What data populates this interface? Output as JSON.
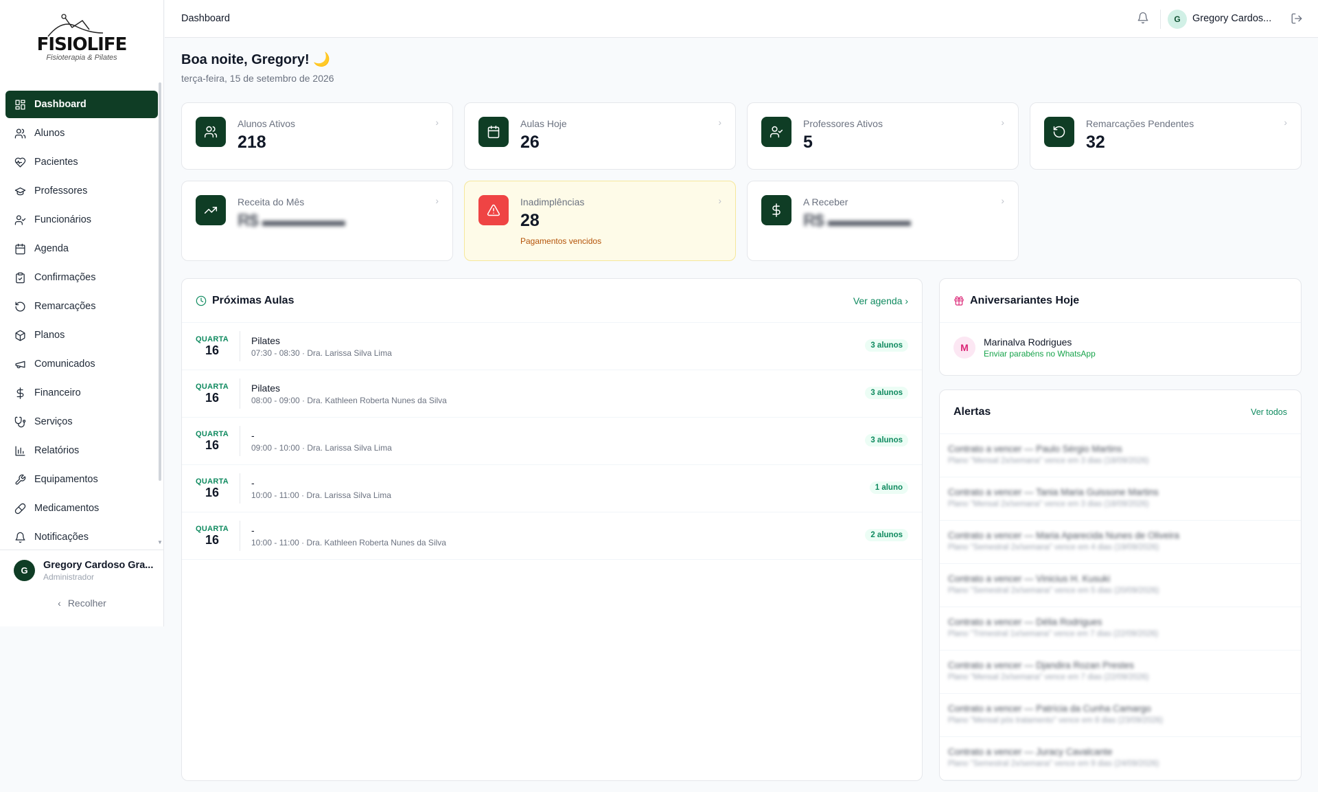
{
  "brand": {
    "name": "FISIOLIFE",
    "tagline": "Fisioterapia & Pilates"
  },
  "sidebar": {
    "items": [
      {
        "label": "Dashboard",
        "icon": "grid-icon",
        "active": true
      },
      {
        "label": "Alunos",
        "icon": "users-icon"
      },
      {
        "label": "Pacientes",
        "icon": "heart-pulse-icon"
      },
      {
        "label": "Professores",
        "icon": "graduation-cap-icon"
      },
      {
        "label": "Funcionários",
        "icon": "user-check-icon"
      },
      {
        "label": "Agenda",
        "icon": "calendar-icon"
      },
      {
        "label": "Confirmações",
        "icon": "clipboard-check-icon"
      },
      {
        "label": "Remarcações",
        "icon": "rotate-ccw-icon"
      },
      {
        "label": "Planos",
        "icon": "package-icon"
      },
      {
        "label": "Comunicados",
        "icon": "megaphone-icon"
      },
      {
        "label": "Financeiro",
        "icon": "dollar-icon"
      },
      {
        "label": "Serviços",
        "icon": "stethoscope-icon"
      },
      {
        "label": "Relatórios",
        "icon": "bar-chart-icon"
      },
      {
        "label": "Equipamentos",
        "icon": "wrench-icon"
      },
      {
        "label": "Medicamentos",
        "icon": "pill-icon"
      },
      {
        "label": "Notificações",
        "icon": "bell-icon"
      }
    ],
    "user": {
      "initial": "G",
      "name": "Gregory Cardoso Gra...",
      "role": "Administrador"
    },
    "collapse_label": "Recolher"
  },
  "header": {
    "title": "Dashboard",
    "user_initial": "G",
    "user_name": "Gregory Cardos..."
  },
  "greeting": {
    "text": "Boa noite, Gregory! 🌙",
    "date": "terça-feira, 15 de setembro de 2026"
  },
  "stats": [
    {
      "label": "Alunos Ativos",
      "value": "218",
      "icon": "users-icon"
    },
    {
      "label": "Aulas Hoje",
      "value": "26",
      "icon": "calendar-icon"
    },
    {
      "label": "Professores Ativos",
      "value": "5",
      "icon": "user-check-icon"
    },
    {
      "label": "Remarcações Pendentes",
      "value": "32",
      "icon": "rotate-ccw-icon"
    },
    {
      "label": "Receita do Mês",
      "value": "R$ ▬▬▬▬▬",
      "icon": "trending-up-icon"
    },
    {
      "label": "Inadimplências",
      "value": "28",
      "sub": "Pagamentos vencidos",
      "icon": "alert-triangle-icon"
    },
    {
      "label": "A Receber",
      "value": "R$ ▬▬▬▬▬",
      "icon": "dollar-icon"
    }
  ],
  "upcoming": {
    "title": "Próximas Aulas",
    "link": "Ver agenda",
    "rows": [
      {
        "day": "QUARTA",
        "num": "16",
        "name": "Pilates",
        "meta": "07:30 - 08:30 · Dra. Larissa Silva Lima",
        "badge": "3 alunos"
      },
      {
        "day": "QUARTA",
        "num": "16",
        "name": "Pilates",
        "meta": "08:00 - 09:00 · Dra. Kathleen Roberta Nunes da Silva",
        "badge": "3 alunos"
      },
      {
        "day": "QUARTA",
        "num": "16",
        "name": "-",
        "meta": "09:00 - 10:00 · Dra. Larissa Silva Lima",
        "badge": "3 alunos"
      },
      {
        "day": "QUARTA",
        "num": "16",
        "name": "-",
        "meta": "10:00 - 11:00 · Dra. Larissa Silva Lima",
        "badge": "1 aluno"
      },
      {
        "day": "QUARTA",
        "num": "16",
        "name": "-",
        "meta": "10:00 - 11:00 · Dra. Kathleen Roberta Nunes da Silva",
        "badge": "2 alunos"
      }
    ]
  },
  "birthdays": {
    "title": "Aniversariantes Hoje",
    "people": [
      {
        "initial": "M",
        "name": "Marinalva Rodrigues",
        "action": "Enviar parabéns no WhatsApp"
      }
    ]
  },
  "alerts": {
    "title": "Alertas",
    "link": "Ver todos",
    "rows": [
      {
        "title": "Contrato a vencer — Paulo Sérgio Martins",
        "sub": "Plano \"Mensal 2x/semana\" vence em 3 dias (18/09/2026)"
      },
      {
        "title": "Contrato a vencer — Tania Maria Guissone Martins",
        "sub": "Plano \"Mensal 2x/semana\" vence em 3 dias (18/09/2026)"
      },
      {
        "title": "Contrato a vencer — Maria Aparecida Nunes de Oliveira",
        "sub": "Plano \"Semestral 2x/semana\" vence em 4 dias (19/09/2026)"
      },
      {
        "title": "Contrato a vencer — Vinicius H. Kusuki",
        "sub": "Plano \"Semestral 2x/semana\" vence em 5 dias (20/09/2026)"
      },
      {
        "title": "Contrato a vencer — Délia Rodrigues",
        "sub": "Plano \"Trimestral 1x/semana\" vence em 7 dias (22/09/2026)"
      },
      {
        "title": "Contrato a vencer — Djandira Rozan Prestes",
        "sub": "Plano \"Mensal 2x/semana\" vence em 7 dias (22/09/2026)"
      },
      {
        "title": "Contrato a vencer — Patrícia da Cunha Camargo",
        "sub": "Plano \"Mensal pós tratamento\" vence em 8 dias (23/09/2026)"
      },
      {
        "title": "Contrato a vencer — Juracy Cavalcante",
        "sub": "Plano \"Semestral 2x/semana\" vence em 9 dias (24/09/2026)"
      }
    ]
  },
  "colors": {
    "primary": "#0f3d25",
    "accent": "#0f8a5f",
    "danger": "#ef4444",
    "warn_bg": "#fefbe8"
  }
}
